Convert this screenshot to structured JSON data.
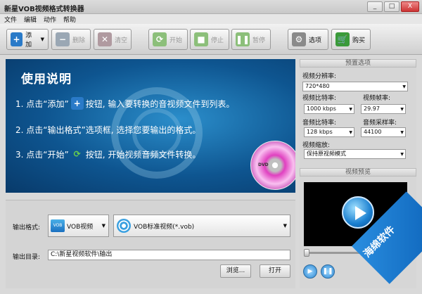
{
  "window": {
    "title": "新星VOB视频格式转换器",
    "controls": [
      "_",
      "□",
      "X"
    ]
  },
  "menu": [
    "文件",
    "编辑",
    "动作",
    "帮助"
  ],
  "toolbar": {
    "add": "添加",
    "delete": "删除",
    "clear": "清空",
    "start": "开始",
    "stop": "停止",
    "pause": "暂停",
    "options": "选项",
    "buy": "购买"
  },
  "banner": {
    "title": "使用说明",
    "step1a": "1. 点击“添加”",
    "step1b": "按钮, 输入要转换的音视频文件到列表。",
    "step2": "2. 点击“输出格式”选项框, 选择您要输出的格式。",
    "step3a": "3. 点击“开始”",
    "step3b": "按钮, 开始视频音频文件转换。",
    "disc_text": "DVD"
  },
  "output": {
    "format_label": "输出格式:",
    "category": "VOB视频",
    "format": "VOB标准视频(*.vob)",
    "dir_label": "输出目录:",
    "dir_value": "C:\\新星视频软件\\输出",
    "browse": "浏览...",
    "open": "打开"
  },
  "preset": {
    "header": "预置选项",
    "resolution_label": "视频分辨率:",
    "resolution": "720*480",
    "vbitrate_label": "视频比特率:",
    "vbitrate": "1000 kbps",
    "fps_label": "视频帧率:",
    "fps": "29.97",
    "abitrate_label": "音频比特率:",
    "abitrate": "128 kbps",
    "samplerate_label": "音频采样率:",
    "samplerate": "44100",
    "zoom_label": "视频缩放:",
    "zoom": "保持原视频模式"
  },
  "preview": {
    "header": "视频预览",
    "slider_fraction": 0.0
  },
  "watermark": "海绵软件"
}
